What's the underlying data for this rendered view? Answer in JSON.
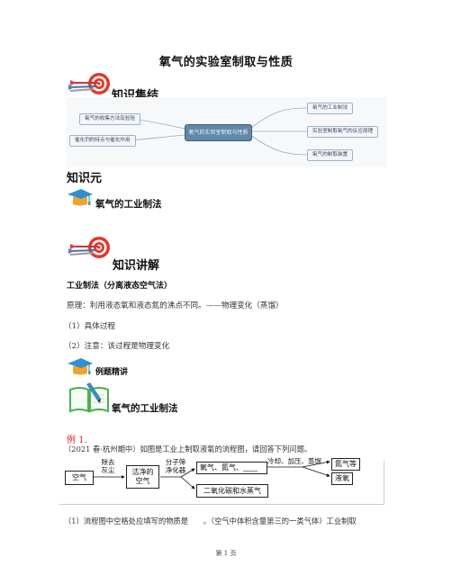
{
  "document": {
    "title": "氧气的实验室制取与性质",
    "sections": {
      "summary_heading": "知识集结",
      "knowledge_unit_heading": "知识元",
      "topic_1": "氧气的工业制法",
      "explain_heading": "知识讲解",
      "examples_heading": "例题精讲",
      "example_topic": "氧气的工业制法"
    },
    "mindmap": {
      "center": "氧气的实验室制取与性质",
      "left_nodes": [
        "氧气的收集方法及验验",
        "催化剂的特点与催化作用"
      ],
      "right_nodes": [
        "氧气的工业制法",
        "实验室制取氧气的反应原理",
        "氧气的制取装置"
      ]
    },
    "explanation": {
      "heading": "工业制法（分离液态空气法）",
      "principle": "原理：利用液态氧和液态氮的沸点不同。——物理变化（蒸馏）",
      "step_1": "（1）具体过程",
      "step_2": "（2）注意：该过程是物理变化"
    },
    "example": {
      "label": "例 1.",
      "source_line": "（2021 春·杭州期中）如图是工业上制取液氧的流程图，请回答下列问题。",
      "question_1": "（1）流程图中空格处应填写的物质是　　。（空气中体积含量第三的一类气体）工业制取"
    },
    "flowchart": {
      "box_air": "空气",
      "label_dust_1": "除去",
      "label_dust_2": "灰尘",
      "box_clean_1": "洁净的",
      "box_clean_2": "空气",
      "label_sieve_1": "分子筛",
      "label_sieve_2": "净化器",
      "box_gases": "氧气、氮气、____",
      "box_co2": "二氧化碳和水蒸气",
      "label_process": "冷却、加压、蒸馏",
      "box_nitrogen": "氮气等",
      "box_liquid_oxygen": "液氧"
    },
    "footer": {
      "page_label": "第 1 页"
    },
    "colors": {
      "example_label": "#e8231f",
      "mindmap_center": "#5f87a8",
      "mindmap_line": "#8fb0cc"
    }
  }
}
